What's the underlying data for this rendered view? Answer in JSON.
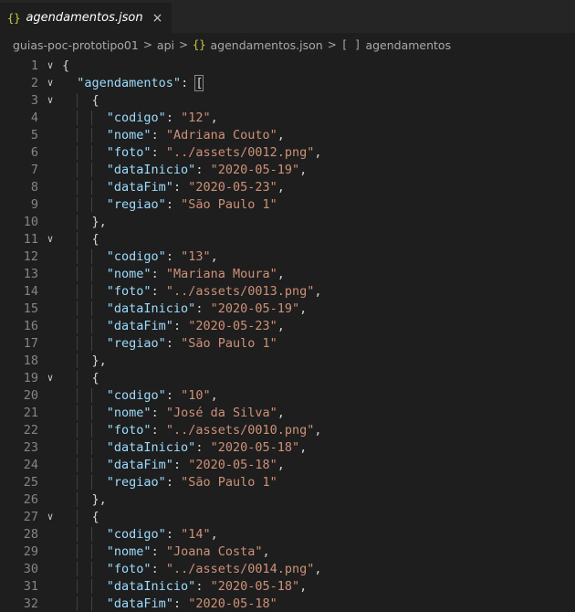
{
  "tab": {
    "title": "agendamentos.json",
    "icon": "{}",
    "close": "×"
  },
  "breadcrumb": {
    "items": [
      "guias-poc-prototipo01",
      "api",
      "agendamentos.json",
      "agendamentos"
    ],
    "file_icon": "{}",
    "array_icon": "[ ]",
    "separator": ">"
  },
  "editor": {
    "root_key": "agendamentos",
    "records": [
      {
        "codigo": "12",
        "nome": "Adriana Couto",
        "foto": "../assets/0012.png",
        "dataInicio": "2020-05-19",
        "dataFim": "2020-05-23",
        "regiao": "São Paulo 1"
      },
      {
        "codigo": "13",
        "nome": "Mariana Moura",
        "foto": "../assets/0013.png",
        "dataInicio": "2020-05-19",
        "dataFim": "2020-05-23",
        "regiao": "São Paulo 1"
      },
      {
        "codigo": "10",
        "nome": "José da Silva",
        "foto": "../assets/0010.png",
        "dataInicio": "2020-05-18",
        "dataFim": "2020-05-18",
        "regiao": "São Paulo 1"
      },
      {
        "codigo": "14",
        "nome": "Joana Costa",
        "foto": "../assets/0014.png",
        "dataInicio": "2020-05-18",
        "dataFim": "2020-05-18"
      }
    ],
    "first_line_number": 1,
    "last_line_number": 32
  },
  "colors": {
    "key": "#9cdcfe",
    "string": "#ce9178",
    "punct": "#d4d4d4",
    "line_number": "#858585"
  }
}
